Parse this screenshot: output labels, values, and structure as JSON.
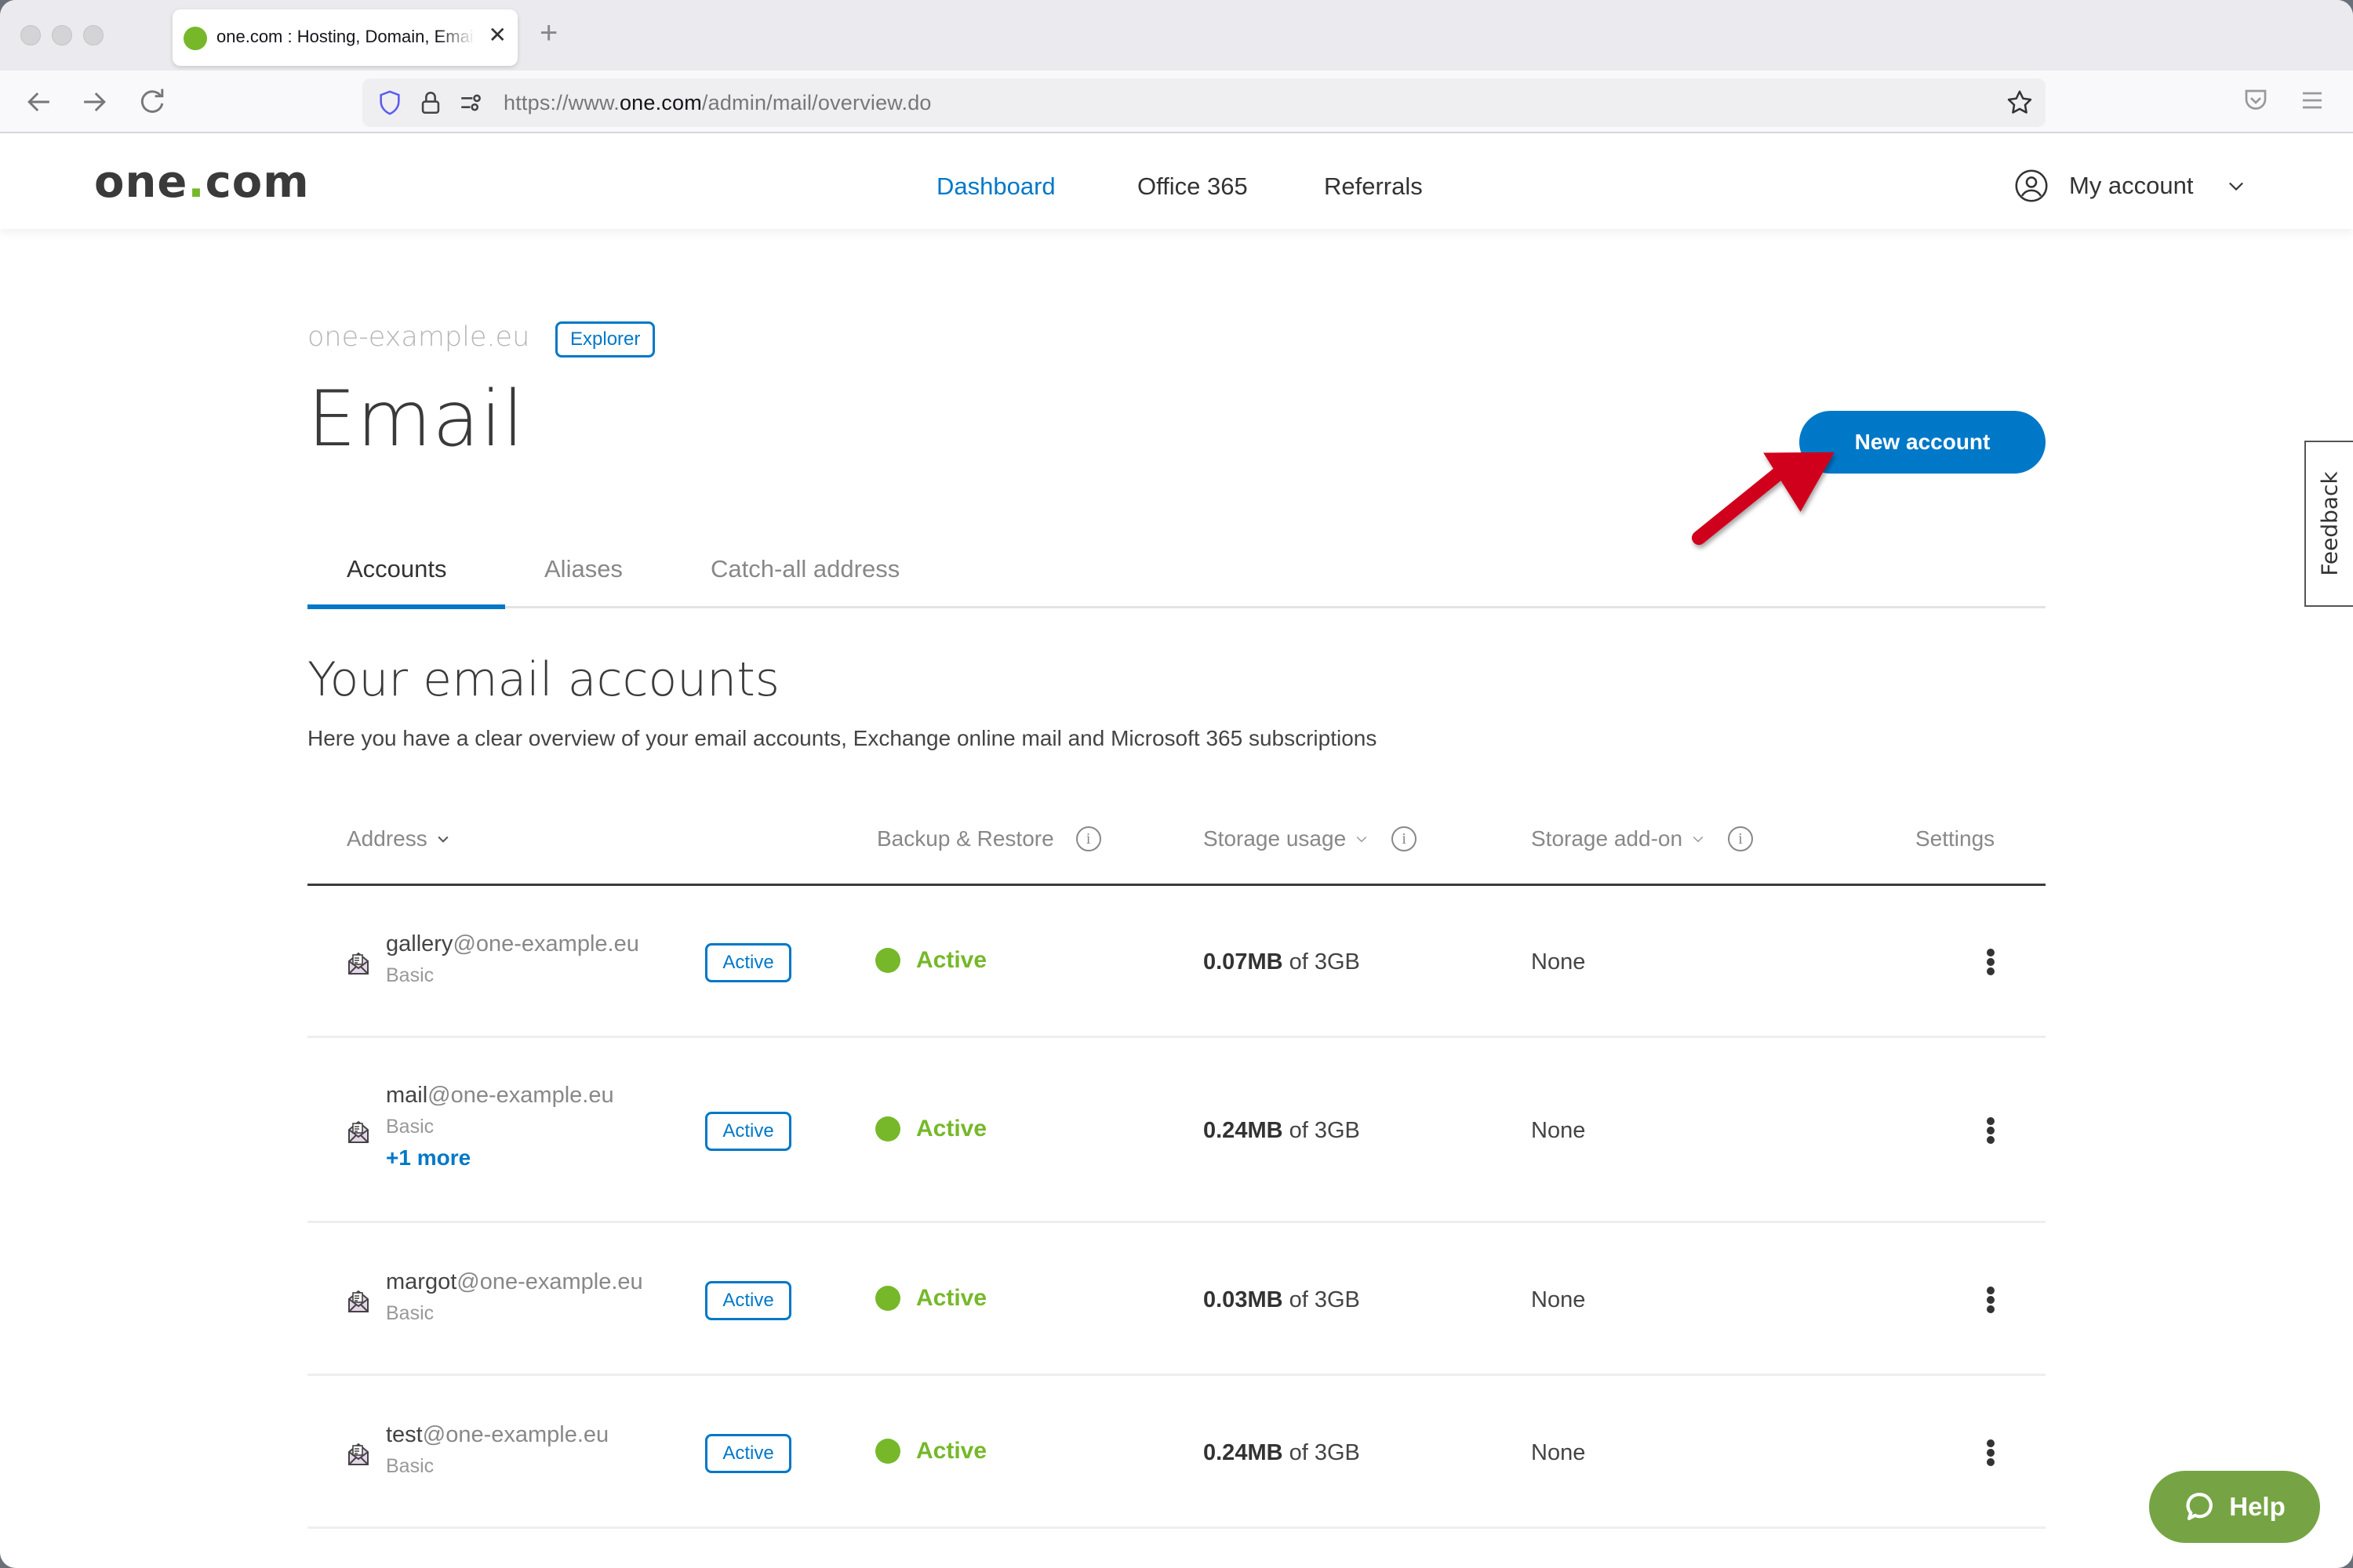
{
  "browser": {
    "tab_title": "one.com : Hosting, Domain, Email",
    "url_prefix": "https://www.",
    "url_host": "one.com",
    "url_path": "/admin/mail/overview.do"
  },
  "header": {
    "logo_main": "one",
    "logo_dot": ".",
    "logo_tld": "com",
    "nav": [
      {
        "label": "Dashboard",
        "active": true
      },
      {
        "label": "Office 365",
        "active": false
      },
      {
        "label": "Referrals",
        "active": false
      }
    ],
    "account_label": "My account"
  },
  "page": {
    "domain": "one-example.eu",
    "plan_badge": "Explorer",
    "title": "Email",
    "new_account_label": "New account",
    "feedback_label": "Feedback",
    "tabs": [
      {
        "label": "Accounts",
        "active": true
      },
      {
        "label": "Aliases",
        "active": false
      },
      {
        "label": "Catch-all address",
        "active": false
      }
    ],
    "section_title": "Your email accounts",
    "section_subtitle": "Here you have a clear overview of your email accounts, Exchange online mail and Microsoft 365 subscriptions"
  },
  "table": {
    "columns": {
      "address": "Address",
      "backup": "Backup & Restore",
      "storage_usage": "Storage usage",
      "storage_addon": "Storage add-on",
      "settings": "Settings"
    },
    "rows": [
      {
        "user": "gallery",
        "domain": "@one-example.eu",
        "plan": "Basic",
        "more": "",
        "badge": "Active",
        "backup": "Active",
        "used": "0.07MB",
        "quota": " of 3GB",
        "addon": "None"
      },
      {
        "user": "mail",
        "domain": "@one-example.eu",
        "plan": "Basic",
        "more": "+1 more",
        "badge": "Active",
        "backup": "Active",
        "used": "0.24MB",
        "quota": " of 3GB",
        "addon": "None"
      },
      {
        "user": "margot",
        "domain": "@one-example.eu",
        "plan": "Basic",
        "more": "",
        "badge": "Active",
        "backup": "Active",
        "used": "0.03MB",
        "quota": " of 3GB",
        "addon": "None"
      },
      {
        "user": "test",
        "domain": "@one-example.eu",
        "plan": "Basic",
        "more": "",
        "badge": "Active",
        "backup": "Active",
        "used": "0.24MB",
        "quota": " of 3GB",
        "addon": "None"
      }
    ]
  },
  "help_label": "Help",
  "colors": {
    "brand_blue": "#0078c8",
    "brand_green": "#76b82a",
    "help_green": "#76a444",
    "annotation_red": "#d0021b"
  }
}
